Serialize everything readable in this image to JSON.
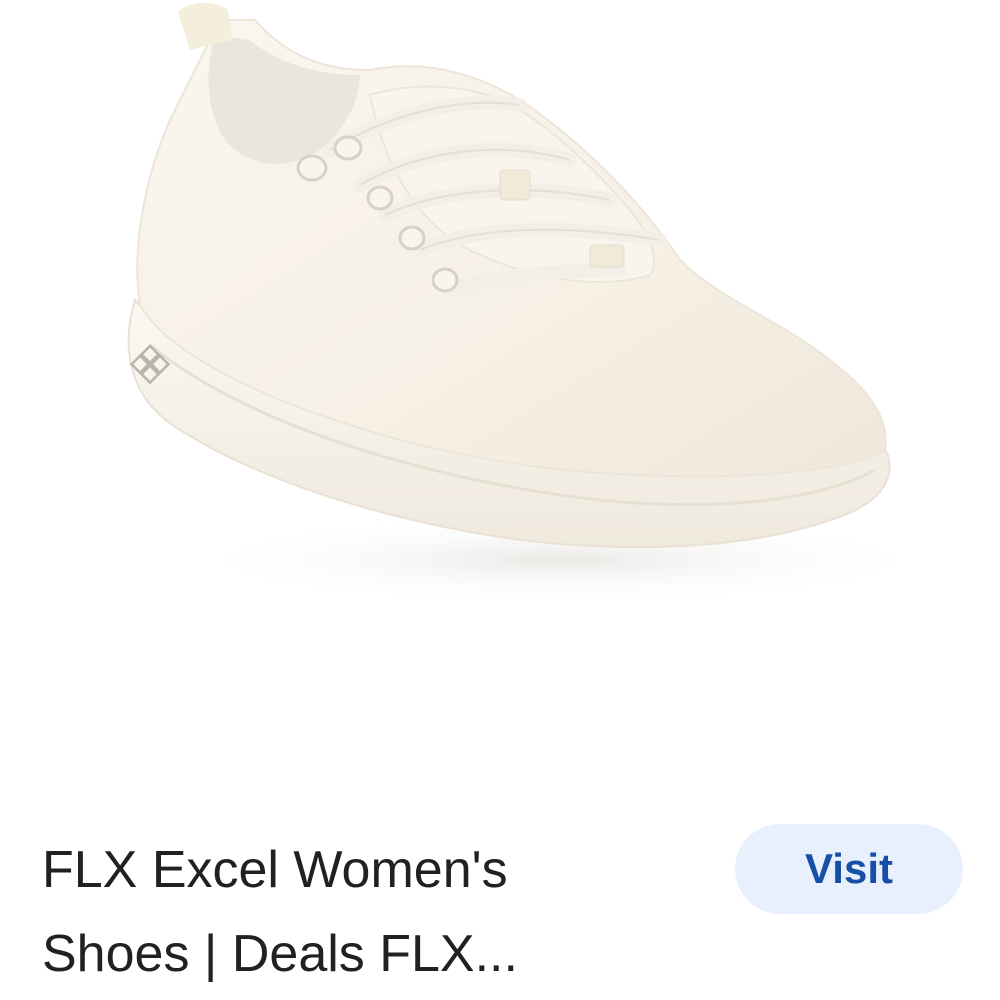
{
  "product": {
    "image_alt": "white wool lace-up sneaker",
    "title_line1": "FLX Excel Women's",
    "title_line2": "Shoes | Deals FLX..."
  },
  "actions": {
    "visit_label": "Visit"
  },
  "colors": {
    "visit_bg": "#e8f0fe",
    "visit_text": "#174ea6",
    "title_text": "#202124",
    "shoe_body": "#f7f1e6"
  }
}
